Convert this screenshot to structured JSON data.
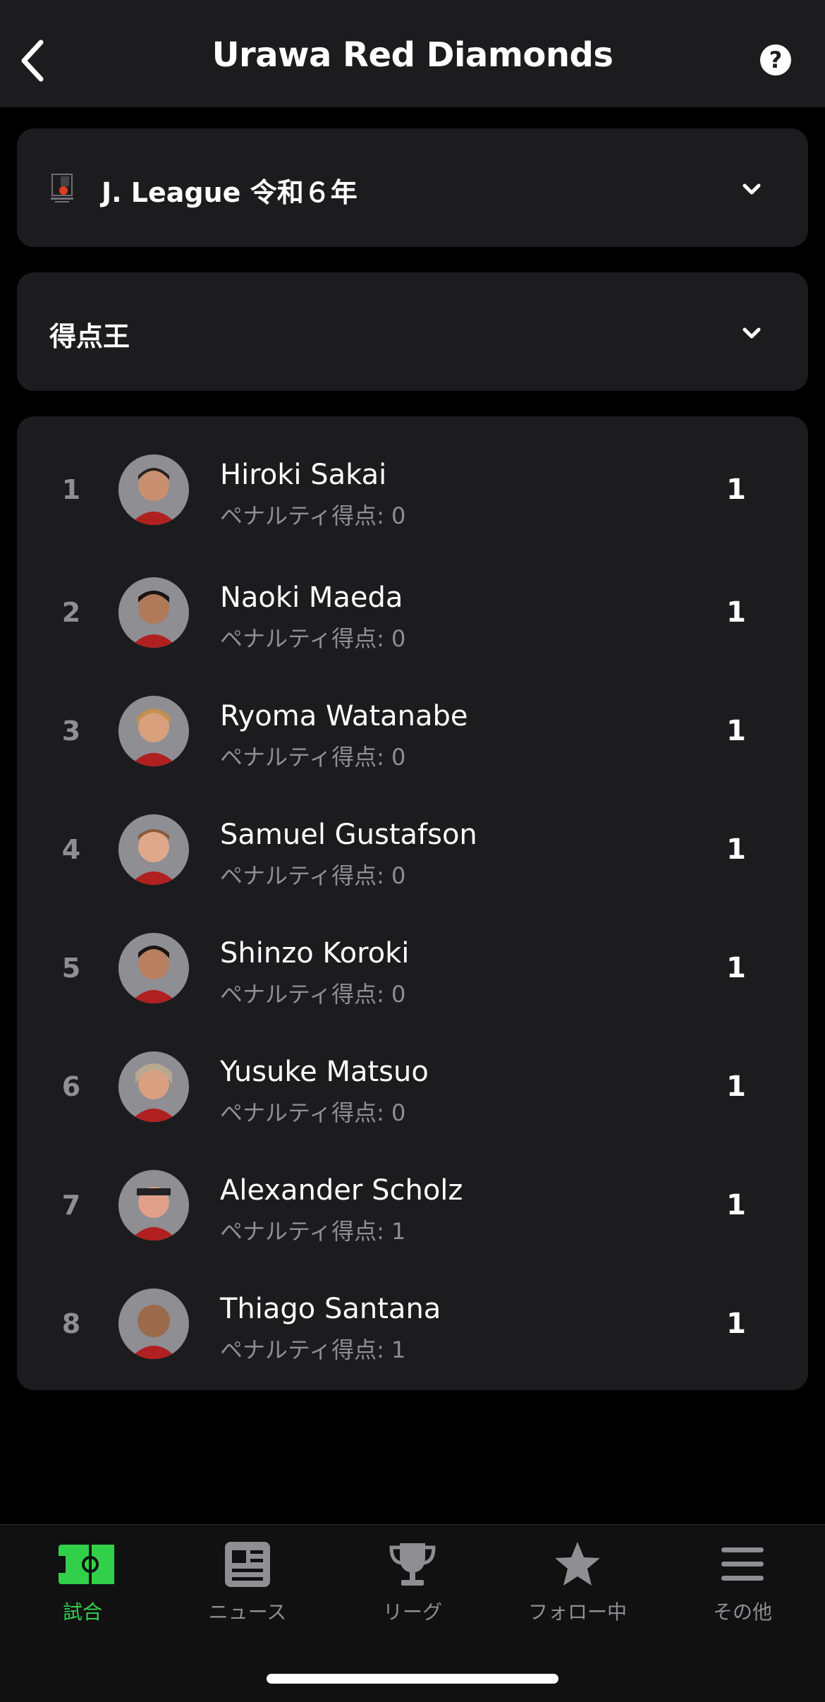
{
  "header": {
    "title": "Urawa Red Diamonds",
    "help_label": "?"
  },
  "league_select": {
    "label": "J. League 令和６年",
    "logo_text": "J.LEAGUE"
  },
  "stat_select": {
    "label": "得点王"
  },
  "players": [
    {
      "rank": "1",
      "name": "Hiroki Sakai",
      "sub": "ペナルティ得点: 0",
      "goals": "1"
    },
    {
      "rank": "2",
      "name": "Naoki Maeda",
      "sub": "ペナルティ得点: 0",
      "goals": "1"
    },
    {
      "rank": "3",
      "name": "Ryoma Watanabe",
      "sub": "ペナルティ得点: 0",
      "goals": "1"
    },
    {
      "rank": "4",
      "name": "Samuel Gustafson",
      "sub": "ペナルティ得点: 0",
      "goals": "1"
    },
    {
      "rank": "5",
      "name": "Shinzo Koroki",
      "sub": "ペナルティ得点: 0",
      "goals": "1"
    },
    {
      "rank": "6",
      "name": "Yusuke Matsuo",
      "sub": "ペナルティ得点: 0",
      "goals": "1"
    },
    {
      "rank": "7",
      "name": "Alexander Scholz",
      "sub": "ペナルティ得点: 1",
      "goals": "1"
    },
    {
      "rank": "8",
      "name": "Thiago Santana",
      "sub": "ペナルティ得点: 1",
      "goals": "1"
    }
  ],
  "tabs": [
    {
      "label": "試合",
      "icon": "pitch-icon",
      "active": true
    },
    {
      "label": "ニュース",
      "icon": "news-icon",
      "active": false
    },
    {
      "label": "リーグ",
      "icon": "trophy-icon",
      "active": false
    },
    {
      "label": "フォロー中",
      "icon": "star-icon",
      "active": false
    },
    {
      "label": "その他",
      "icon": "menu-icon",
      "active": false
    }
  ],
  "colors": {
    "accent": "#32d04a",
    "card": "#1c1c1e",
    "muted": "#8e8e93"
  }
}
